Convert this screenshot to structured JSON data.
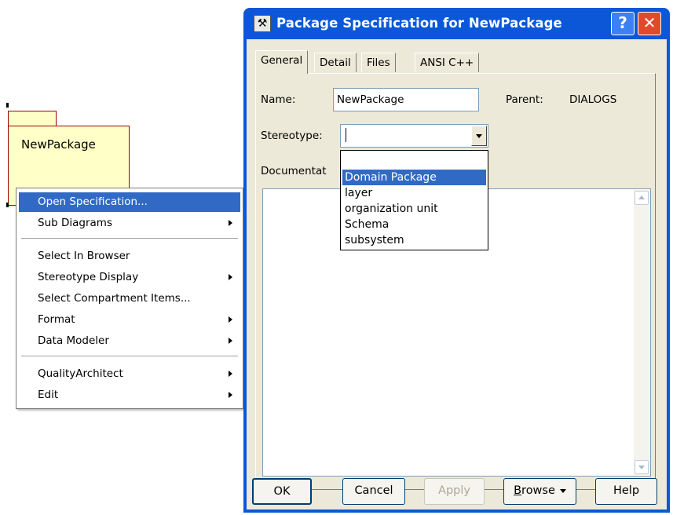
{
  "canvas": {
    "package_name": "NewPackage"
  },
  "context_menu": {
    "items": [
      {
        "label": "Open Specification...",
        "has_submenu": false,
        "highlighted": true
      },
      {
        "label": "Sub Diagrams",
        "has_submenu": true
      },
      {
        "label": "Select In Browser",
        "has_submenu": false
      },
      {
        "label": "Stereotype Display",
        "has_submenu": true
      },
      {
        "label": "Select Compartment Items...",
        "has_submenu": false
      },
      {
        "label": "Format",
        "has_submenu": true
      },
      {
        "label": "Data Modeler",
        "has_submenu": true
      },
      {
        "label": "QualityArchitect",
        "has_submenu": true
      },
      {
        "label": "Edit",
        "has_submenu": true
      }
    ]
  },
  "dialog": {
    "title": "Package Specification for NewPackage",
    "help_glyph": "?",
    "close_glyph": "✕",
    "tabs": [
      {
        "label": "General",
        "active": true
      },
      {
        "label": "Detail"
      },
      {
        "label": "Files"
      },
      {
        "label": "ANSI C++"
      }
    ],
    "name_label": "Name:",
    "name_value": "NewPackage",
    "parent_label": "Parent:",
    "parent_value": "DIALOGS",
    "stereotype_label": "Stereotype:",
    "stereotype_value": "",
    "stereotype_options": [
      "Domain Package",
      "layer",
      "organization unit",
      "Schema",
      "subsystem"
    ],
    "stereotype_highlighted": "Domain Package",
    "documentation_label": "Documentat",
    "documentation_value": "",
    "buttons": {
      "ok": "OK",
      "cancel": "Cancel",
      "apply": "Apply",
      "browse_first": "B",
      "browse_rest": "rowse",
      "help": "Help"
    }
  },
  "colors": {
    "titlebar": "#0b57d8",
    "highlight": "#316ac5",
    "package_fill": "#ffffc8",
    "package_border": "#a00000",
    "dialog_face": "#ece9d8"
  }
}
